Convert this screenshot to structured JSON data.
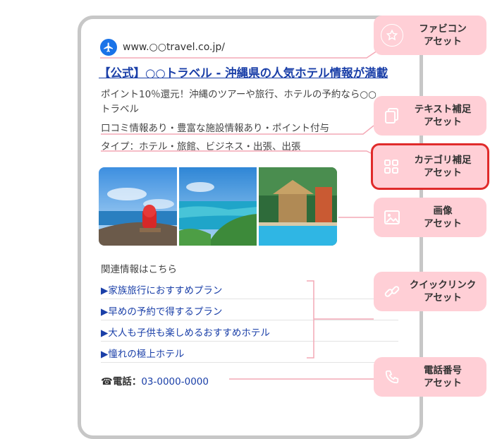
{
  "ad": {
    "domain": "www.○○travel.co.jp/",
    "title": "【公式】○○トラベル - 沖縄県の人気ホテル情報が満載",
    "description": "ポイント10％還元！沖縄のツアーや旅行、ホテルの予約なら○○トラベル",
    "callout": "口コミ情報あり・豊富な施設情報あり・ポイント付与",
    "structured_snippet": "タイプ：ホテル・旅館、ビジネス・出張、出張",
    "related_heading": "関連情報はこちら",
    "sitelinks": [
      "▶家族旅行におすすめプラン",
      "▶早めの予約で得するプラン",
      "▶大人も子供も楽しめるおすすめホテル",
      "▶憧れの極上ホテル"
    ],
    "phone_label": "☎電話：",
    "phone_number": "03-0000-0000"
  },
  "badges": [
    {
      "icon": "star-icon",
      "line1": "ファビコン",
      "line2": "アセット"
    },
    {
      "icon": "copy-icon",
      "line1": "テキスト補足",
      "line2": "アセット"
    },
    {
      "icon": "grid-icon",
      "line1": "カテゴリ補足",
      "line2": "アセット"
    },
    {
      "icon": "image-icon",
      "line1": "画像",
      "line2": "アセット"
    },
    {
      "icon": "link-icon",
      "line1": "クイックリンク",
      "line2": "アセット"
    },
    {
      "icon": "phone-icon",
      "line1": "電話番号",
      "line2": "アセット"
    }
  ],
  "colors": {
    "badge_bg": "#ffcfd6",
    "connector": "#f4a9b6",
    "link": "#1a3fa8",
    "highlight": "#e02b2b"
  }
}
